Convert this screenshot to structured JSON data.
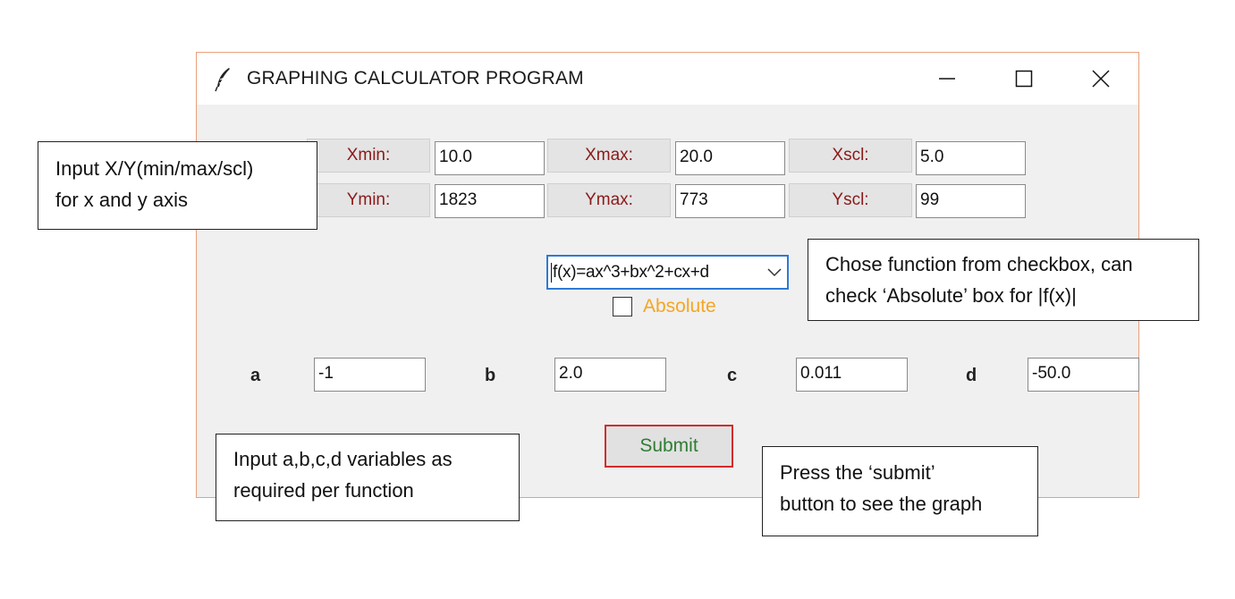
{
  "window": {
    "title": "GRAPHING CALCULATOR PROGRAM"
  },
  "axis": {
    "xmin_label": "Xmin:",
    "xmin_value": "10.0",
    "xmax_label": "Xmax:",
    "xmax_value": "20.0",
    "xscl_label": "Xscl:",
    "xscl_value": "5.0",
    "ymin_label": "Ymin:",
    "ymin_value": "1823",
    "ymax_label": "Ymax:",
    "ymax_value": "773",
    "yscl_label": "Yscl:",
    "yscl_value": "99"
  },
  "function": {
    "selected": "f(x)=ax^3+bx^2+cx+d",
    "absolute_label": "Absolute",
    "absolute_checked": false
  },
  "variables": {
    "a_label": "a",
    "a_value": "-1",
    "b_label": "b",
    "b_value": "2.0",
    "c_label": "c",
    "c_value": "0.011",
    "d_label": "d",
    "d_value": "-50.0"
  },
  "submit_label": "Submit",
  "annotations": {
    "axis_note": [
      "Input  X/Y(min/max/scl)",
      "for x and y axis"
    ],
    "function_note": [
      "Chose function from checkbox, can",
      "check ‘Absolute’ box for |f(x)|"
    ],
    "variables_note": [
      "Input a,b,c,d variables as",
      "required per function"
    ],
    "submit_note": [
      "Press the ‘submit’",
      "button to see the graph"
    ]
  },
  "colors": {
    "label_text": "#8b1a1a",
    "absolute_text": "#f5a623",
    "submit_text": "#2e7d32",
    "submit_border": "#d42b2b",
    "combo_border": "#2f79d6"
  }
}
